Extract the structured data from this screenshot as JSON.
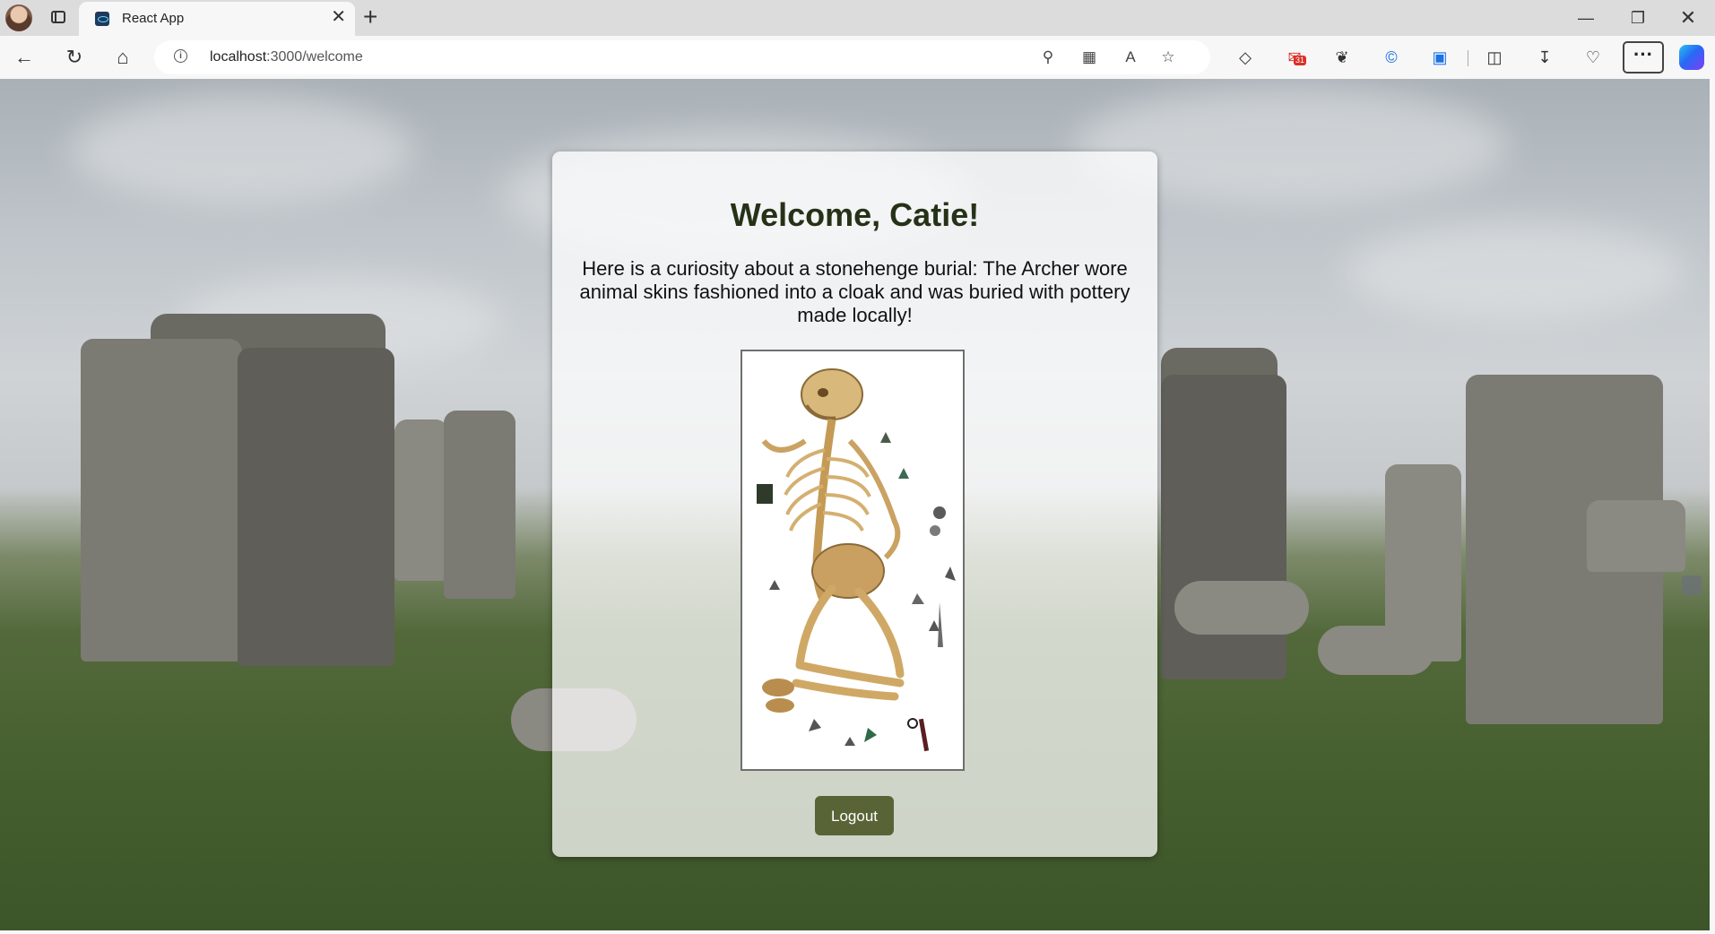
{
  "browser": {
    "tab_title": "React App",
    "tab_close": "✕",
    "new_tab": "+",
    "url_host": "localhost",
    "url_path": ":3000/welcome",
    "window_minimize": "—",
    "window_restore": "❐",
    "window_close": "✕",
    "more_label": "···",
    "gmail_badge": "31",
    "info_glyph": "i"
  },
  "page": {
    "title": "Welcome, Catie!",
    "curiosity": "Here is a curiosity about a stonehenge burial: The Archer wore animal skins fashioned into a cloak and was buried with pottery made locally!",
    "logout_label": "Logout"
  },
  "colors": {
    "title": "#263218",
    "button": "#586436"
  }
}
